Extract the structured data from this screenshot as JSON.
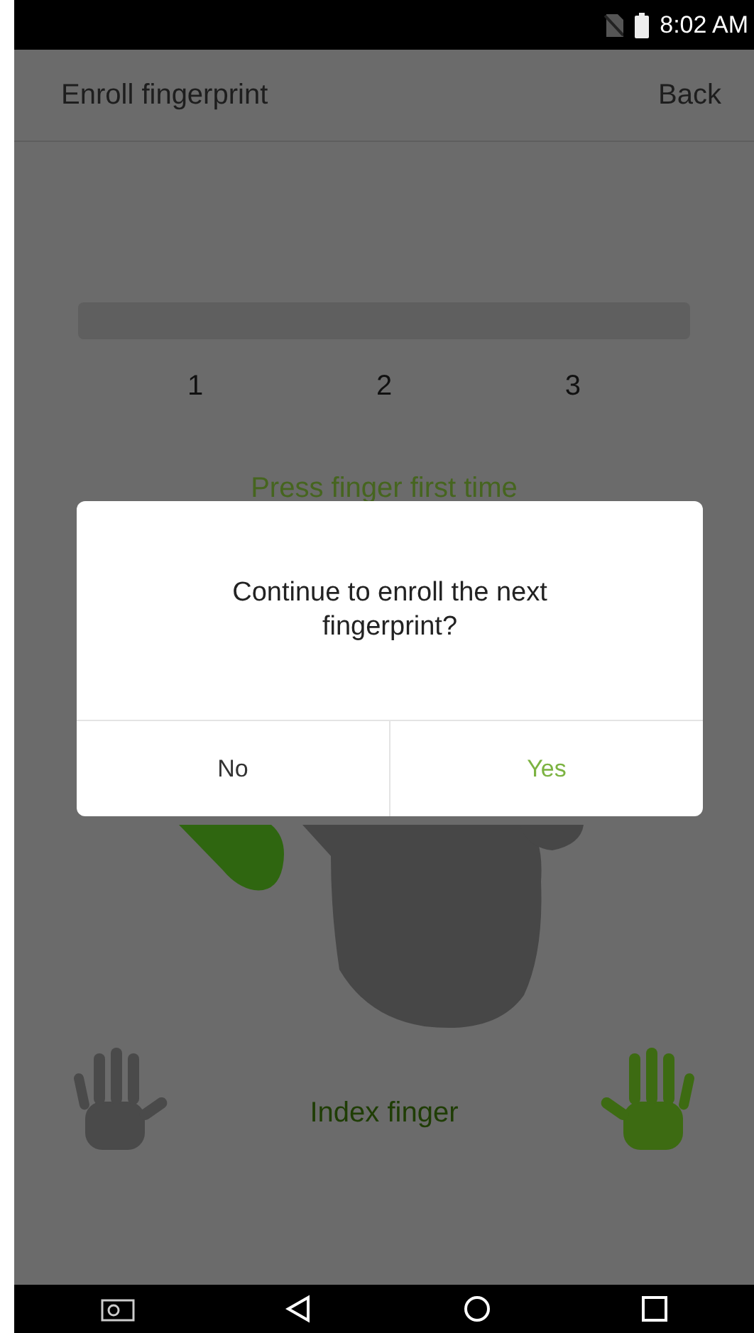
{
  "status_bar": {
    "time": "8:02 AM"
  },
  "header": {
    "title": "Enroll fingerprint",
    "back": "Back"
  },
  "steps": [
    {
      "label": "1"
    },
    {
      "label": "2"
    },
    {
      "label": "3"
    }
  ],
  "prompt": "Press finger first time",
  "hands": [
    {
      "kind": "left",
      "selected": false
    },
    {
      "kind": "right",
      "selected": true
    }
  ],
  "finger_label": "Index finger",
  "dialog": {
    "message": "Continue to enroll the next fingerprint?",
    "buttons": [
      {
        "label": "No",
        "kind": "negative"
      },
      {
        "label": "Yes",
        "kind": "positive"
      }
    ]
  }
}
